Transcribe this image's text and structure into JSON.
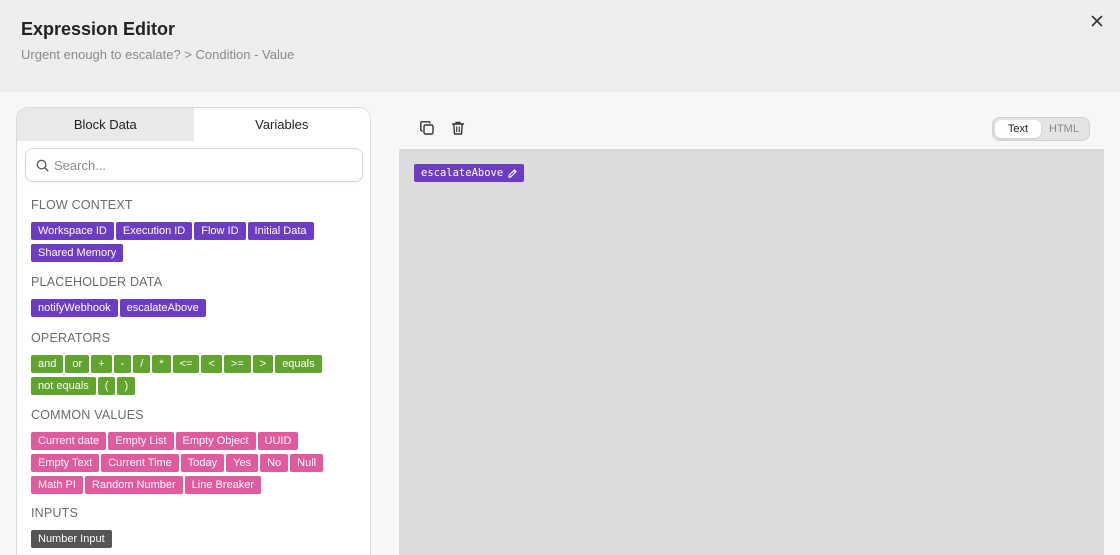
{
  "header": {
    "title": "Expression Editor",
    "breadcrumb": "Urgent enough to escalate? > Condition - Value",
    "close_icon": "close-icon"
  },
  "tabs": [
    {
      "label": "Block Data",
      "active": false
    },
    {
      "label": "Variables",
      "active": true
    }
  ],
  "search": {
    "placeholder": "Search...",
    "value": ""
  },
  "sections": {
    "flow_context": {
      "title": "FLOW CONTEXT",
      "items": [
        "Workspace ID",
        "Execution ID",
        "Flow ID",
        "Initial Data",
        "Shared Memory"
      ]
    },
    "placeholder_data": {
      "title": "PLACEHOLDER DATA",
      "items": [
        "notifyWebhook",
        "escalateAbove"
      ]
    },
    "operators": {
      "title": "OPERATORS",
      "items": [
        "and",
        "or",
        "+",
        "-",
        "/",
        "*",
        "<=",
        "<",
        ">=",
        ">",
        "equals",
        "not equals",
        "(",
        ")"
      ]
    },
    "common_values": {
      "title": "COMMON VALUES",
      "items": [
        "Current date",
        "Empty List",
        "Empty Object",
        "UUID",
        "Empty Text",
        "Current Time",
        "Today",
        "Yes",
        "No",
        "Null",
        "Math PI",
        "Random Number",
        "Line Breaker"
      ]
    },
    "inputs": {
      "title": "INPUTS",
      "items": [
        "Number Input"
      ]
    }
  },
  "toolbar": {
    "copy_icon": "copy-icon",
    "delete_icon": "trash-icon",
    "toggle": [
      {
        "label": "Text",
        "active": true
      },
      {
        "label": "HTML",
        "active": false
      }
    ]
  },
  "editor": {
    "token_label": "escalateAbove",
    "token_icon": "pencil-icon"
  },
  "colors": {
    "purple": "#6c3cc4",
    "green": "#62a52e",
    "pink": "#e05a9e",
    "dark": "#555555",
    "editor_bg": "#dcdcdc"
  }
}
